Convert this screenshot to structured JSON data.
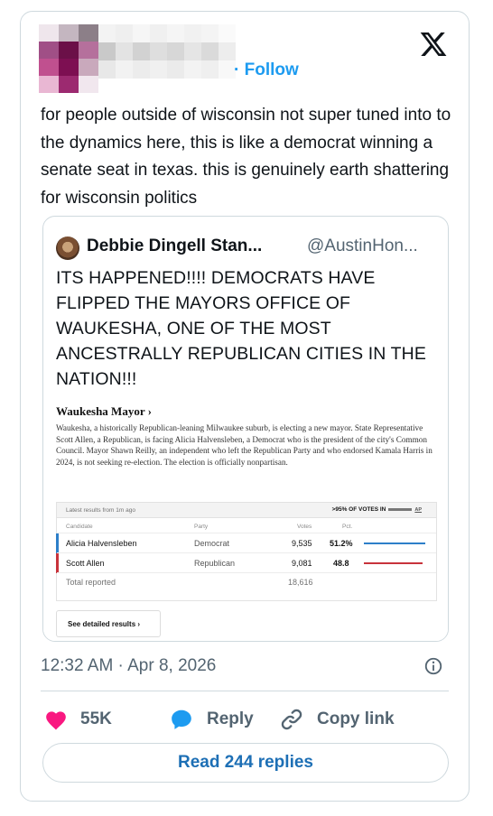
{
  "header": {
    "follow_label": "· Follow"
  },
  "tweet": {
    "text": "for people outside of wisconsin not super tuned into to the dynamics here, this is like a democrat winning a senate seat in texas.  this is genuinely earth shattering for wisconsin politics"
  },
  "quote": {
    "display_name": "Debbie Dingell Stan...",
    "handle": "@AustinHon...",
    "text": "ITS HAPPENED!!!! DEMOCRATS HAVE FLIPPED THE MAYORS OFFICE OF WAUKESHA, ONE OF THE MOST ANCESTRALLY REPUBLICAN CITIES IN THE NATION!!!",
    "image": {
      "title": "Waukesha Mayor ›",
      "description": "Waukesha, a historically Republican-leaning Milwaukee suburb, is electing a new mayor. State Representative Scott Allen, a Republican, is facing Alicia Halvensleben, a Democrat who is the president of the city's Common Council. Mayor Shawn Reilly, an independent who left the Republican Party and who endorsed Kamala Harris in 2024, is not seeking re-election. The election is officially nonpartisan.",
      "latest_results": "Latest results from 1m ago",
      "reporting": ">95% OF VOTES IN",
      "source": "AP",
      "columns": {
        "candidate": "Candidate",
        "party": "Party",
        "votes": "Votes",
        "pct": "Pct."
      },
      "rows": [
        {
          "candidate": "Alicia Halvensleben",
          "party": "Democrat",
          "votes": "9,535",
          "pct": "51.2%",
          "color": "#2d7fc9",
          "pct_value": 51.2
        },
        {
          "candidate": "Scott Allen",
          "party": "Republican",
          "votes": "9,081",
          "pct": "48.8",
          "color": "#c8333b",
          "pct_value": 48.8
        }
      ],
      "total_label": "Total reported",
      "total_votes": "18,616",
      "detail_button": "See detailed results ›"
    }
  },
  "meta": {
    "timestamp": "12:32 AM · Apr 8, 2026"
  },
  "actions": {
    "likes": "55K",
    "reply": "Reply",
    "copy_link": "Copy link"
  },
  "read_replies": "Read 244 replies",
  "colors": {
    "accent": "#1d9bf0",
    "like": "#f91880",
    "democrat": "#2d7fc9",
    "republican": "#c8333b"
  }
}
